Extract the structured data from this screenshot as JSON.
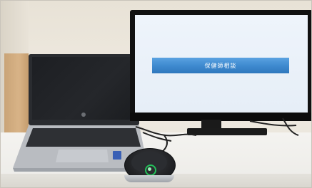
{
  "monitor": {
    "banner_text": "保健師相談"
  },
  "colors": {
    "wall": "#ece6db",
    "desk": "#f2f1ee",
    "screen_background": "#e9f1f9",
    "banner": "#3f8bd0",
    "monitor_bezel": "#111111",
    "speaker_ring_led": "#23c25a"
  },
  "icons": [
    "power-icon"
  ]
}
